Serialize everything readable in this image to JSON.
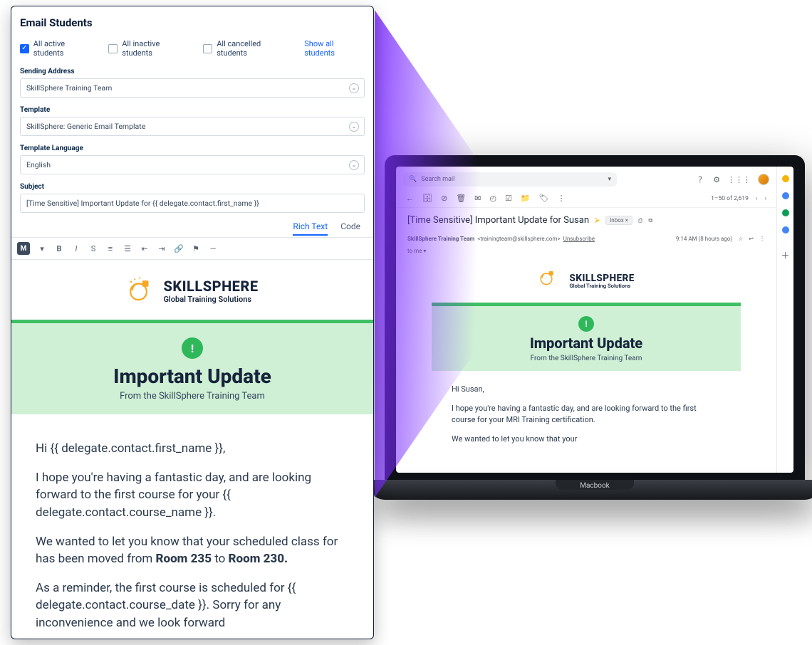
{
  "composer": {
    "title": "Email Students",
    "filters": {
      "active": {
        "label": "All active students",
        "checked": true
      },
      "inactive": {
        "label": "All inactive students",
        "checked": false
      },
      "cancelled": {
        "label": "All cancelled students",
        "checked": false
      },
      "show_all_link": "Show all students"
    },
    "fields": {
      "sending_address": {
        "label": "Sending Address",
        "value": "SkillSphere Training Team"
      },
      "template": {
        "label": "Template",
        "value": "SkillSphere: Generic Email Template"
      },
      "template_language": {
        "label": "Template Language",
        "value": "English"
      },
      "subject": {
        "label": "Subject",
        "value": "[Time Sensitive] Important Update for {{ delegate.contact.first_name }}"
      }
    },
    "tabs": {
      "rich": "Rich Text",
      "code": "Code"
    },
    "toolbar_chip": "M"
  },
  "brand": {
    "name": "SKILLSPHERE",
    "tagline": "Global Training Solutions"
  },
  "banner": {
    "title": "Important Update",
    "subtitle": "From the SkillSphere Training Team",
    "icon_glyph": "!"
  },
  "template_body": {
    "greeting": "Hi {{ delegate.contact.first_name }},",
    "p1": "I hope you're having a fantastic day, and are looking forward to the first course for your {{ delegate.contact.course_name }}.",
    "p2_a": "We wanted to let you know that your scheduled class for  has been moved from ",
    "p2_room_from": "Room 235",
    "p2_mid": " to ",
    "p2_room_to": "Room 230.",
    "p3": "As a reminder, the first course is scheduled for {{ delegate.contact.course_date }}. Sorry for any inconvenience  and we look forward"
  },
  "inbox": {
    "search_placeholder": "Search mail",
    "count": "1–50 of 2,619",
    "subject": "[Time Sensitive] Important Update for Susan",
    "badge": "Inbox ×",
    "from_name": "SkillSphere Training Team",
    "from_email": "<trainingteam@skillsphere.com>",
    "unsubscribe": "Unsubscribe",
    "to_line": "to me ▾",
    "time": "9:14 AM (8 hours ago)",
    "body": {
      "greeting": "Hi Susan,",
      "p1": "I hope you're having a fantastic day, and are looking forward to the first course for your MRI Training certification.",
      "p2": "We wanted to let you know that your"
    }
  },
  "laptop_label": "Macbook"
}
